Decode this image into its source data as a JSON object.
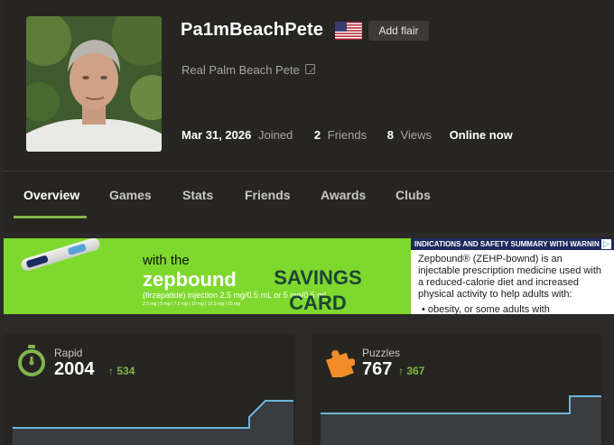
{
  "profile": {
    "username": "Pa1mBeachPete",
    "flag": "us-flag-icon",
    "add_flair": "Add flair",
    "real_name": "Real Palm Beach Pete",
    "joined_date": "Mar 31, 2026",
    "joined_label": "Joined",
    "friends_count": "2",
    "friends_label": "Friends",
    "views_count": "8",
    "views_label": "Views",
    "online_status": "Online now"
  },
  "tabs": [
    "Overview",
    "Games",
    "Stats",
    "Friends",
    "Awards",
    "Clubs"
  ],
  "active_tab": "Overview",
  "ad": {
    "with_text": "with the",
    "brand": "zepbound",
    "brand_sub": "(tirzepatide) injection 2.5 mg/0.5 mL or 5 mg/0.5 mL",
    "dose_line": "2.5 mg | 5 mg | 7.5 mg | 10 mg | 12.5 mg | 15 mg",
    "savings_line1": "SAVINGS",
    "savings_line2": "CARD",
    "isi_header": "INDICATIONS AND SAFETY SUMMARY WITH WARNIN",
    "isi_text": "Zepbound® (ZEHP-bownd) is an injectable prescription medicine used with a reduced-calorie diet and increased physical activity to help adults with:",
    "isi_bullet": "obesity, or some adults with"
  },
  "cards": [
    {
      "title": "Rapid",
      "rating": "2004",
      "delta": "534",
      "icon": "stopwatch-icon"
    },
    {
      "title": "Puzzles",
      "rating": "767",
      "delta": "367",
      "icon": "puzzle-piece-icon"
    }
  ],
  "colors": {
    "accent_green": "#81b64c",
    "rapid_icon": "#81b64c",
    "puzzle_icon": "#f08c2a",
    "graph_line": "#6bb6d8",
    "ad_green": "#7fd82e"
  }
}
